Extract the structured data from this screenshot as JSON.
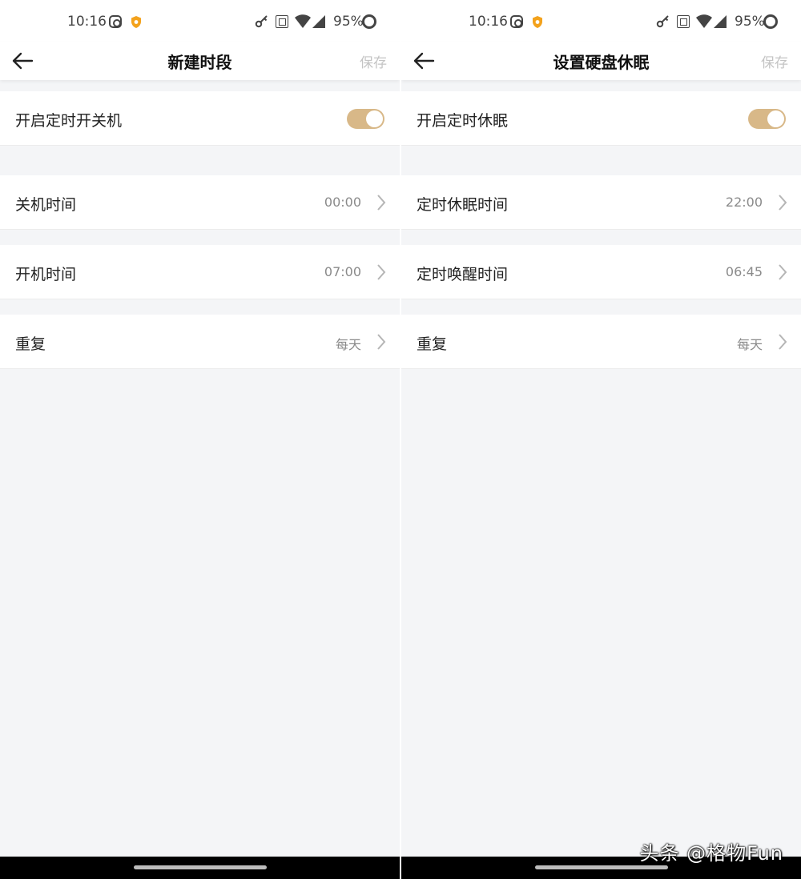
{
  "status_bar": {
    "time": "10:16",
    "battery": "95%"
  },
  "left": {
    "title": "新建时段",
    "save_label": "保存",
    "toggle_row": {
      "label": "开启定时开关机",
      "enabled": true
    },
    "rows": [
      {
        "label": "关机时间",
        "value": "00:00"
      },
      {
        "label": "开机时间",
        "value": "07:00"
      },
      {
        "label": "重复",
        "value": "每天"
      }
    ]
  },
  "right": {
    "title": "设置硬盘休眠",
    "save_label": "保存",
    "toggle_row": {
      "label": "开启定时休眠",
      "enabled": true
    },
    "rows": [
      {
        "label": "定时休眠时间",
        "value": "22:00"
      },
      {
        "label": "定时唤醒时间",
        "value": "06:45"
      },
      {
        "label": "重复",
        "value": "每天"
      }
    ]
  },
  "watermark": "头条 @格物Fun",
  "colors": {
    "toggle_on": "#d8b888",
    "save_disabled": "#c4c4c4",
    "background": "#f4f5f7"
  }
}
